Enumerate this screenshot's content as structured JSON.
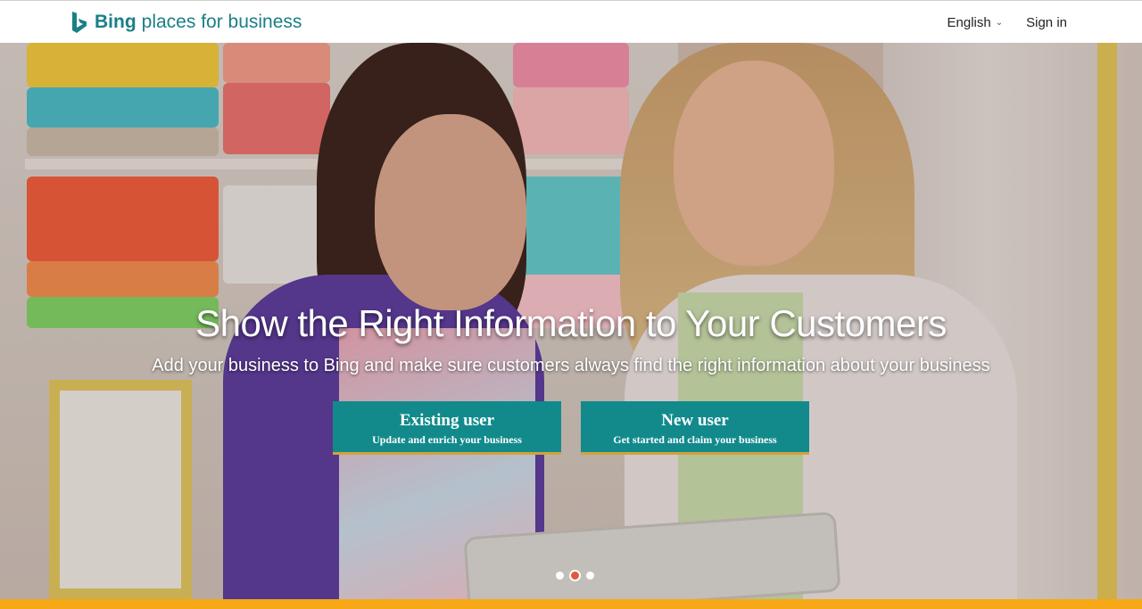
{
  "header": {
    "brand_bold": "Bing",
    "brand_rest": "places for business",
    "language_label": "English",
    "signin_label": "Sign in",
    "accent_color": "#1a7f86"
  },
  "hero": {
    "headline": "Show the Right Information to Your Customers",
    "subline": "Add your business to Bing and make sure customers always find the right information about your business",
    "existing_user": {
      "title": "Existing user",
      "subtitle": "Update and enrich your business"
    },
    "new_user": {
      "title": "New user",
      "subtitle": "Get started and claim your business"
    },
    "button_color": "#128a8c",
    "carousel": {
      "total_slides": 3,
      "active_slide": 2
    }
  },
  "footer_bar_color": "#f6a817"
}
